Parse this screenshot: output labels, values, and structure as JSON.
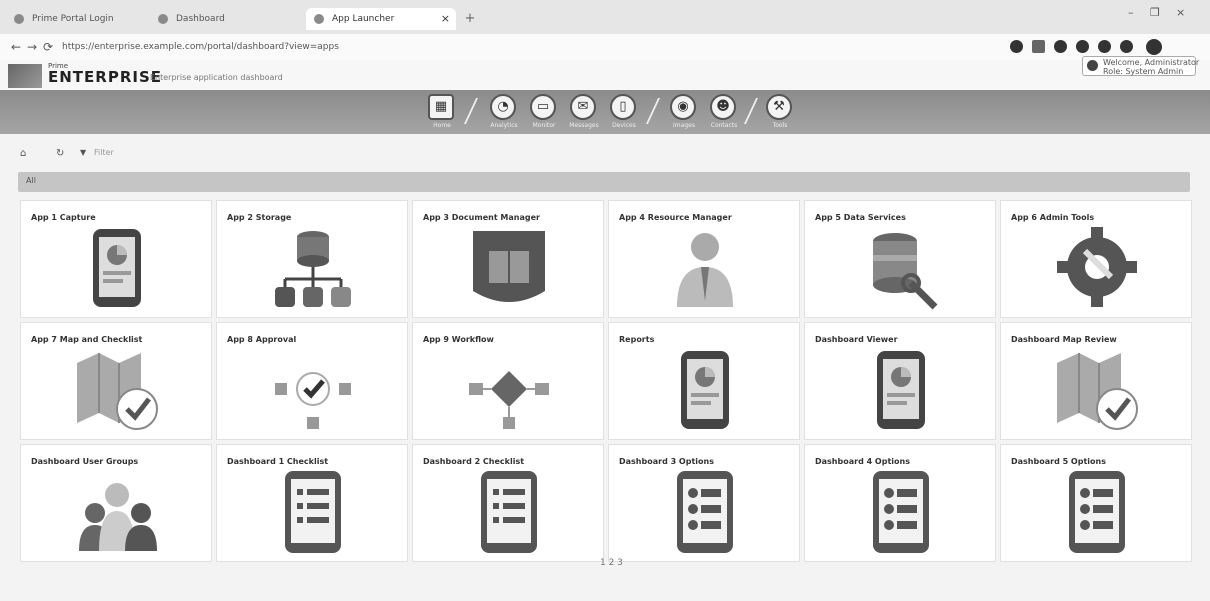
{
  "browser": {
    "tabs": [
      {
        "label": "Prime Portal Login"
      },
      {
        "label": "Dashboard"
      },
      {
        "label": "App Launcher"
      }
    ],
    "new_tab": "+",
    "window_controls": [
      "–",
      "❐",
      "×"
    ],
    "nav": {
      "back": "←",
      "forward": "→",
      "reload": "⟳"
    },
    "url": "https://enterprise.example.com/portal/dashboard?view=apps",
    "ext_icons": [
      "extension-icon",
      "star-icon",
      "profile-icon",
      "menu-icon"
    ]
  },
  "app": {
    "brand_small": "Prime",
    "brand": "ENTERPRISE",
    "subtitle": "Enterprise application dashboard",
    "user_name": "Welcome, Administrator",
    "user_role": "Role: System Admin"
  },
  "nav": [
    {
      "label": "Home",
      "icon": "home-icon",
      "glyph": "▦"
    },
    {
      "label": "Analytics",
      "icon": "chart-icon",
      "glyph": "◔"
    },
    {
      "label": "Monitor",
      "icon": "monitor-icon",
      "glyph": "▭"
    },
    {
      "label": "Messages",
      "icon": "mail-icon",
      "glyph": "✉"
    },
    {
      "label": "Devices",
      "icon": "tablet-icon",
      "glyph": "▯"
    },
    {
      "label": "Images",
      "icon": "camera-icon",
      "glyph": "◉"
    },
    {
      "label": "Contacts",
      "icon": "people-icon",
      "glyph": "☻"
    },
    {
      "label": "Tools",
      "icon": "wrench-icon",
      "glyph": "⚒"
    }
  ],
  "toolbar": {
    "home": "⌂",
    "refresh": "↻",
    "filter": "▼",
    "filter_label": "Filter"
  },
  "filterbar_label": "All",
  "cards": [
    {
      "title": "App 1 Capture",
      "meta": "",
      "icon": "tablet-chart-icon"
    },
    {
      "title": "App 2 Storage",
      "meta": "",
      "icon": "database-network-icon"
    },
    {
      "title": "App 3 Document Manager",
      "meta": "",
      "icon": "book-icon"
    },
    {
      "title": "App 4 Resource Manager",
      "meta": "",
      "icon": "person-icon"
    },
    {
      "title": "App 5 Data Services",
      "meta": "",
      "icon": "database-wrench-icon"
    },
    {
      "title": "App 6 Admin Tools",
      "meta": "",
      "icon": "gear-hammer-icon"
    },
    {
      "title": "App 7 Map and Checklist",
      "meta": "",
      "icon": "map-check-icon"
    },
    {
      "title": "App 8 Approval",
      "meta": "",
      "icon": "workflow-check-icon"
    },
    {
      "title": "App 9 Workflow",
      "meta": "",
      "icon": "workflow-diamond-icon"
    },
    {
      "title": "Reports",
      "meta": "",
      "icon": "tablet-chart-icon"
    },
    {
      "title": "Dashboard Viewer",
      "meta": "",
      "icon": "tablet-chart-icon"
    },
    {
      "title": "Dashboard Map Review",
      "meta": "",
      "icon": "map-check-icon"
    },
    {
      "title": "Dashboard User Groups",
      "meta": "",
      "icon": "people-icon"
    },
    {
      "title": "Dashboard 1 Checklist",
      "meta": "",
      "icon": "tablet-list-icon"
    },
    {
      "title": "Dashboard 2 Checklist",
      "meta": "",
      "icon": "tablet-list-icon"
    },
    {
      "title": "Dashboard 3 Options",
      "meta": "",
      "icon": "tablet-options-icon"
    },
    {
      "title": "Dashboard 4 Options",
      "meta": "",
      "icon": "tablet-options-icon"
    },
    {
      "title": "Dashboard 5 Options",
      "meta": "",
      "icon": "tablet-options-icon"
    }
  ],
  "pager": "1   2   3"
}
